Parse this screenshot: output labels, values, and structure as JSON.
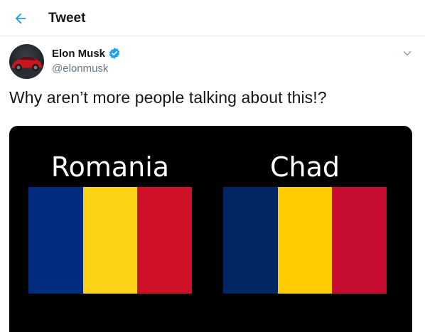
{
  "header": {
    "title": "Tweet",
    "back_icon": "arrow-left-icon",
    "accent": "#1da1f2"
  },
  "tweet": {
    "author_name": "Elon Musk",
    "handle": "@elonmusk",
    "verified": true,
    "text": "Why aren’t more people talking about this!?"
  },
  "media": {
    "flags": [
      {
        "label": "Romania",
        "colors": [
          "#002b7f",
          "#fcd116",
          "#ce1126"
        ]
      },
      {
        "label": "Chad",
        "colors": [
          "#002664",
          "#fecb00",
          "#c60c30"
        ]
      }
    ]
  }
}
